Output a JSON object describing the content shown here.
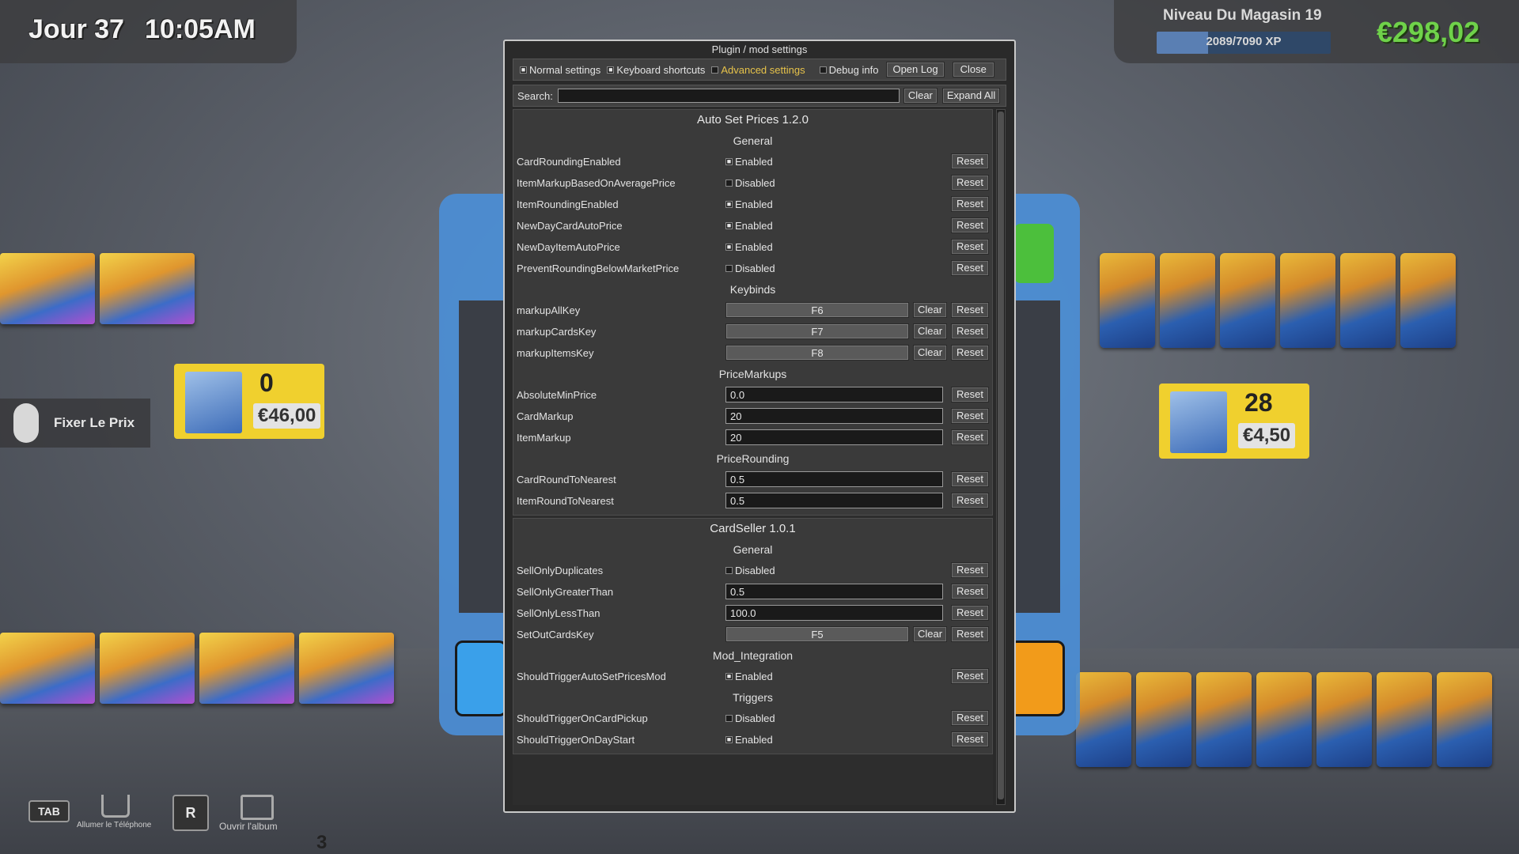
{
  "hud": {
    "day": "Jour 37",
    "time": "10:05AM",
    "level": "Niveau Du Magasin 19",
    "xp": "2089/7090 XP",
    "xp_fraction": 0.295,
    "money": "€298,02",
    "money_color": "#6fd24a"
  },
  "scene": {
    "tag_left": {
      "qty": "0",
      "price": "€46,00"
    },
    "tag_right": {
      "qty": "28",
      "price": "€4,50"
    },
    "hint": "Fixer Le Prix",
    "bottom": {
      "tab_key": "TAB",
      "phone_label": "Allumer le Téléphone",
      "r_key": "R",
      "album_label": "Ouvrir l'album",
      "count": "3"
    }
  },
  "dialog": {
    "title": "Plugin / mod settings",
    "toolbar": {
      "normal": "Normal settings",
      "keyboard": "Keyboard shortcuts",
      "advanced": "Advanced settings",
      "debug": "Debug info",
      "open_log": "Open Log",
      "close": "Close"
    },
    "search": {
      "label": "Search:",
      "value": "",
      "clear": "Clear",
      "expand": "Expand All"
    },
    "reset_label": "Reset",
    "clear_label": "Clear"
  },
  "sections": [
    {
      "title": "Auto Set Prices 1.2.0",
      "groups": [
        {
          "title": "General",
          "settings": [
            {
              "name": "CardRoundingEnabled",
              "type": "bool",
              "value": "Enabled",
              "checked": true
            },
            {
              "name": "ItemMarkupBasedOnAveragePrice",
              "type": "bool",
              "value": "Disabled",
              "checked": false
            },
            {
              "name": "ItemRoundingEnabled",
              "type": "bool",
              "value": "Enabled",
              "checked": true
            },
            {
              "name": "NewDayCardAutoPrice",
              "type": "bool",
              "value": "Enabled",
              "checked": true
            },
            {
              "name": "NewDayItemAutoPrice",
              "type": "bool",
              "value": "Enabled",
              "checked": true
            },
            {
              "name": "PreventRoundingBelowMarketPrice",
              "type": "bool",
              "value": "Disabled",
              "checked": false
            }
          ]
        },
        {
          "title": "Keybinds",
          "settings": [
            {
              "name": "markupAllKey",
              "type": "key",
              "value": "F6"
            },
            {
              "name": "markupCardsKey",
              "type": "key",
              "value": "F7"
            },
            {
              "name": "markupItemsKey",
              "type": "key",
              "value": "F8"
            }
          ]
        },
        {
          "title": "PriceMarkups",
          "settings": [
            {
              "name": "AbsoluteMinPrice",
              "type": "text",
              "value": "0.0"
            },
            {
              "name": "CardMarkup",
              "type": "text",
              "value": "20"
            },
            {
              "name": "ItemMarkup",
              "type": "text",
              "value": "20"
            }
          ]
        },
        {
          "title": "PriceRounding",
          "settings": [
            {
              "name": "CardRoundToNearest",
              "type": "text",
              "value": "0.5"
            },
            {
              "name": "ItemRoundToNearest",
              "type": "text",
              "value": "0.5"
            }
          ]
        }
      ]
    },
    {
      "title": "CardSeller 1.0.1",
      "groups": [
        {
          "title": "General",
          "settings": [
            {
              "name": "SellOnlyDuplicates",
              "type": "bool",
              "value": "Disabled",
              "checked": false
            },
            {
              "name": "SellOnlyGreaterThan",
              "type": "text",
              "value": "0.5"
            },
            {
              "name": "SellOnlyLessThan",
              "type": "text",
              "value": "100.0"
            },
            {
              "name": "SetOutCardsKey",
              "type": "key",
              "value": "F5"
            }
          ]
        },
        {
          "title": "Mod_Integration",
          "settings": [
            {
              "name": "ShouldTriggerAutoSetPricesMod",
              "type": "bool",
              "value": "Enabled",
              "checked": true
            }
          ]
        },
        {
          "title": "Triggers",
          "settings": [
            {
              "name": "ShouldTriggerOnCardPickup",
              "type": "bool",
              "value": "Disabled",
              "checked": false
            },
            {
              "name": "ShouldTriggerOnDayStart",
              "type": "bool",
              "value": "Enabled",
              "checked": true
            }
          ]
        }
      ]
    }
  ]
}
